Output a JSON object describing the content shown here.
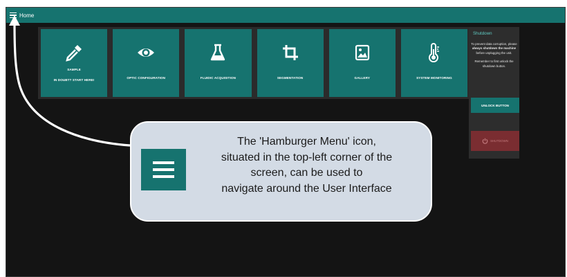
{
  "topbar": {
    "home_label": "Home",
    "menu_icon": "hamburger-menu-icon"
  },
  "tiles": [
    {
      "label_line1": "SAMPLE",
      "label_line2": "IN DOUBT? START HERE!",
      "icon": "eyedropper-icon"
    },
    {
      "label_line1": "OPTIC CONFIGURATION",
      "label_line2": "",
      "icon": "eye-icon"
    },
    {
      "label_line1": "FLUIDIC ACQUISITION",
      "label_line2": "",
      "icon": "flask-icon"
    },
    {
      "label_line1": "SEGMENTATION",
      "label_line2": "",
      "icon": "crop-icon"
    },
    {
      "label_line1": "GALLERY",
      "label_line2": "",
      "icon": "image-icon"
    },
    {
      "label_line1": "SYSTEM MONITORING",
      "label_line2": "",
      "icon": "thermometer-icon"
    }
  ],
  "shutdown": {
    "title": "Shutdown",
    "text_a": "To prevent data corruption, please ",
    "text_b": "always shutdown the machine",
    "text_c": " before unplugging the unit.",
    "text_d": "Remember to first unlock the shutdown button.",
    "unlock_label": "UNLOCK BUTTON",
    "shutdown_label": "SHUTDOWN"
  },
  "callout": {
    "lines": [
      "The 'Hamburger Menu' icon,",
      "situated in the top-left corner of the",
      "screen, can be used to",
      "navigate around the User Interface"
    ]
  },
  "colors": {
    "teal": "#16736f",
    "background": "#141414",
    "callout": "#d3dbe5",
    "shutdown": "#7a2d31"
  }
}
